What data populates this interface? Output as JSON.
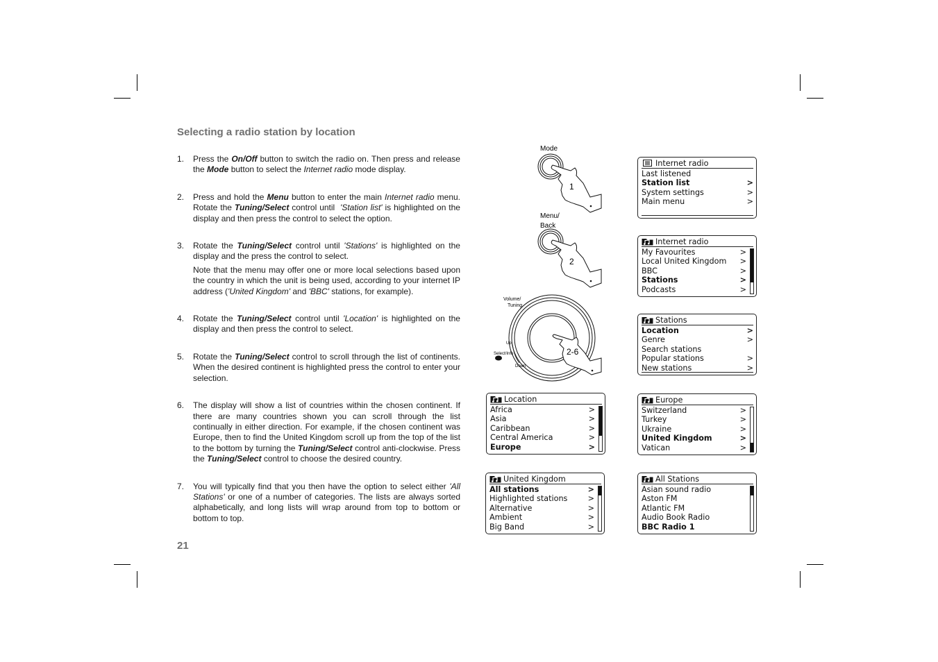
{
  "page": {
    "title": "Selecting a radio station by location",
    "page_number": "21"
  },
  "steps": [
    {
      "num": "1.",
      "html": "Press the <b><i>On/Off</i></b> button to switch the radio on. Then press and release the <b><i>Mode</i></b> button to select the <i>Internet radio</i> mode display."
    },
    {
      "num": "2.",
      "html": "Press and hold the <b><i>Menu</i></b> button to enter the main <i>Internet radio</i> menu. Rotate the <b><i>Tuning/Select</i></b> control until &nbsp;<i>'Station list'</i> is highlighted on the display and then press the control to select the option."
    },
    {
      "num": "3.",
      "html": "Rotate the <b><i>Tuning/Select</i></b> control until <i>'Stations'</i> is highlighted on the display and the press the control to select.",
      "note_html": "Note that the menu may offer one or more local selections based upon the country in which the unit is being used, according to your internet IP address (<i>'United Kingdom'</i> and <i>'BBC'</i> stations, for example)."
    },
    {
      "num": "4.",
      "html": "Rotate the <b><i>Tuning/Select</i></b> control until <i>'Location'</i> is highlighted on the display and then press the control to select."
    },
    {
      "num": "5.",
      "html": "Rotate the <b><i>Tuning/Select</i></b> control to scroll through the list of continents. When the desired continent is highlighted press the control to enter your selection."
    },
    {
      "num": "6.",
      "html": "The display will show a list of countries within the chosen continent. If there are many countries shown you can scroll through the list continually in either direction. For example, if the chosen continent was Europe, then to find the United Kingdom scroll up from the top of the list to the bottom by turning the <b><i>Tuning/Select</i></b> control anti-clockwise. Press the <b><i>Tuning/Select</i></b> control to choose the desired country."
    },
    {
      "num": "7.",
      "html": "You will typically find that you then have the option to select either <i>'All Stations'</i> or one of a number of categories. The lists are always sorted alphabetically, and long lists will wrap around from top to bottom or bottom to top."
    }
  ],
  "illustration": {
    "mode_label": "Mode",
    "mode_step": "1",
    "menu_label_1": "Menu/",
    "menu_label_2": "Back",
    "menu_step": "2",
    "knob_label_1": "Volume/",
    "knob_label_2": "Tuning",
    "knob_step": "2-6",
    "up_label": "Up",
    "down_label": "Down",
    "select_label": "Select/Info"
  },
  "screens": {
    "internet_radio_main": {
      "icon": "list-icon",
      "title": "Internet radio",
      "rows": [
        {
          "label": "Last listened",
          "arrow": ""
        },
        {
          "label": "Station list",
          "arrow": ">",
          "selected": true
        },
        {
          "label": "System settings",
          "arrow": ">"
        },
        {
          "label": "Main menu",
          "arrow": ">"
        }
      ]
    },
    "internet_radio_stations": {
      "icon": "music-folder-icon",
      "title": "Internet radio",
      "scroll_position": 0.75,
      "rows": [
        {
          "label": "My Favourites",
          "arrow": ">"
        },
        {
          "label": "Local United Kingdom",
          "arrow": ">"
        },
        {
          "label": "BBC",
          "arrow": ">"
        },
        {
          "label": "Stations",
          "arrow": ">",
          "selected": true
        },
        {
          "label": "Podcasts",
          "arrow": ">"
        }
      ]
    },
    "stations": {
      "icon": "music-folder-icon",
      "title": "Stations",
      "rows": [
        {
          "label": "Location",
          "arrow": ">",
          "selected": true
        },
        {
          "label": "Genre",
          "arrow": ">"
        },
        {
          "label": "Search stations",
          "arrow": ""
        },
        {
          "label": "Popular stations",
          "arrow": ">"
        },
        {
          "label": "New stations",
          "arrow": ">"
        }
      ]
    },
    "location": {
      "icon": "music-folder-icon",
      "title": "Location",
      "scroll_position": 0.65,
      "rows": [
        {
          "label": "Africa",
          "arrow": ">"
        },
        {
          "label": "Asia",
          "arrow": ">"
        },
        {
          "label": "Caribbean",
          "arrow": ">"
        },
        {
          "label": "Central America",
          "arrow": ">"
        },
        {
          "label": "Europe",
          "arrow": ">",
          "selected": true
        }
      ]
    },
    "europe": {
      "icon": "music-folder-icon",
      "title": "Europe",
      "scroll_position": 0.2,
      "rows": [
        {
          "label": "Switzerland",
          "arrow": ">"
        },
        {
          "label": "Turkey",
          "arrow": ">"
        },
        {
          "label": "Ukraine",
          "arrow": ">"
        },
        {
          "label": "United Kingdom",
          "arrow": ">",
          "selected": true
        },
        {
          "label": "Vatican",
          "arrow": ">"
        }
      ]
    },
    "united_kingdom": {
      "icon": "music-folder-icon",
      "title": "United Kingdom",
      "scroll_position": 0.2,
      "rows": [
        {
          "label": "All stations",
          "arrow": ">",
          "selected": true
        },
        {
          "label": "Highlighted stations",
          "arrow": ">"
        },
        {
          "label": "Alternative",
          "arrow": ">"
        },
        {
          "label": "Ambient",
          "arrow": ">"
        },
        {
          "label": "Big Band",
          "arrow": ">"
        }
      ]
    },
    "all_stations": {
      "icon": "music-folder-icon",
      "title": "All Stations",
      "scroll_position": 0.2,
      "rows": [
        {
          "label": "Asian sound radio",
          "arrow": ""
        },
        {
          "label": "Aston FM",
          "arrow": ""
        },
        {
          "label": "Atlantic FM",
          "arrow": ""
        },
        {
          "label": "Audio Book Radio",
          "arrow": ""
        },
        {
          "label": "BBC Radio 1",
          "arrow": "",
          "selected": true
        }
      ]
    }
  }
}
